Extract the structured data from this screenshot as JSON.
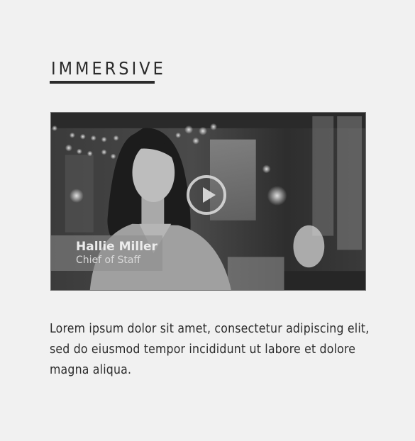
{
  "section": {
    "heading": "IMMERSIVE"
  },
  "video": {
    "play_icon": "play-icon",
    "lower_third": {
      "name": "Hallie Miller",
      "title": "Chief of Staff"
    }
  },
  "description": "Lorem ipsum dolor sit amet, consectetur adipiscing elit, sed do eiusmod tempor incididunt ut labore et dolore magna aliqua."
}
